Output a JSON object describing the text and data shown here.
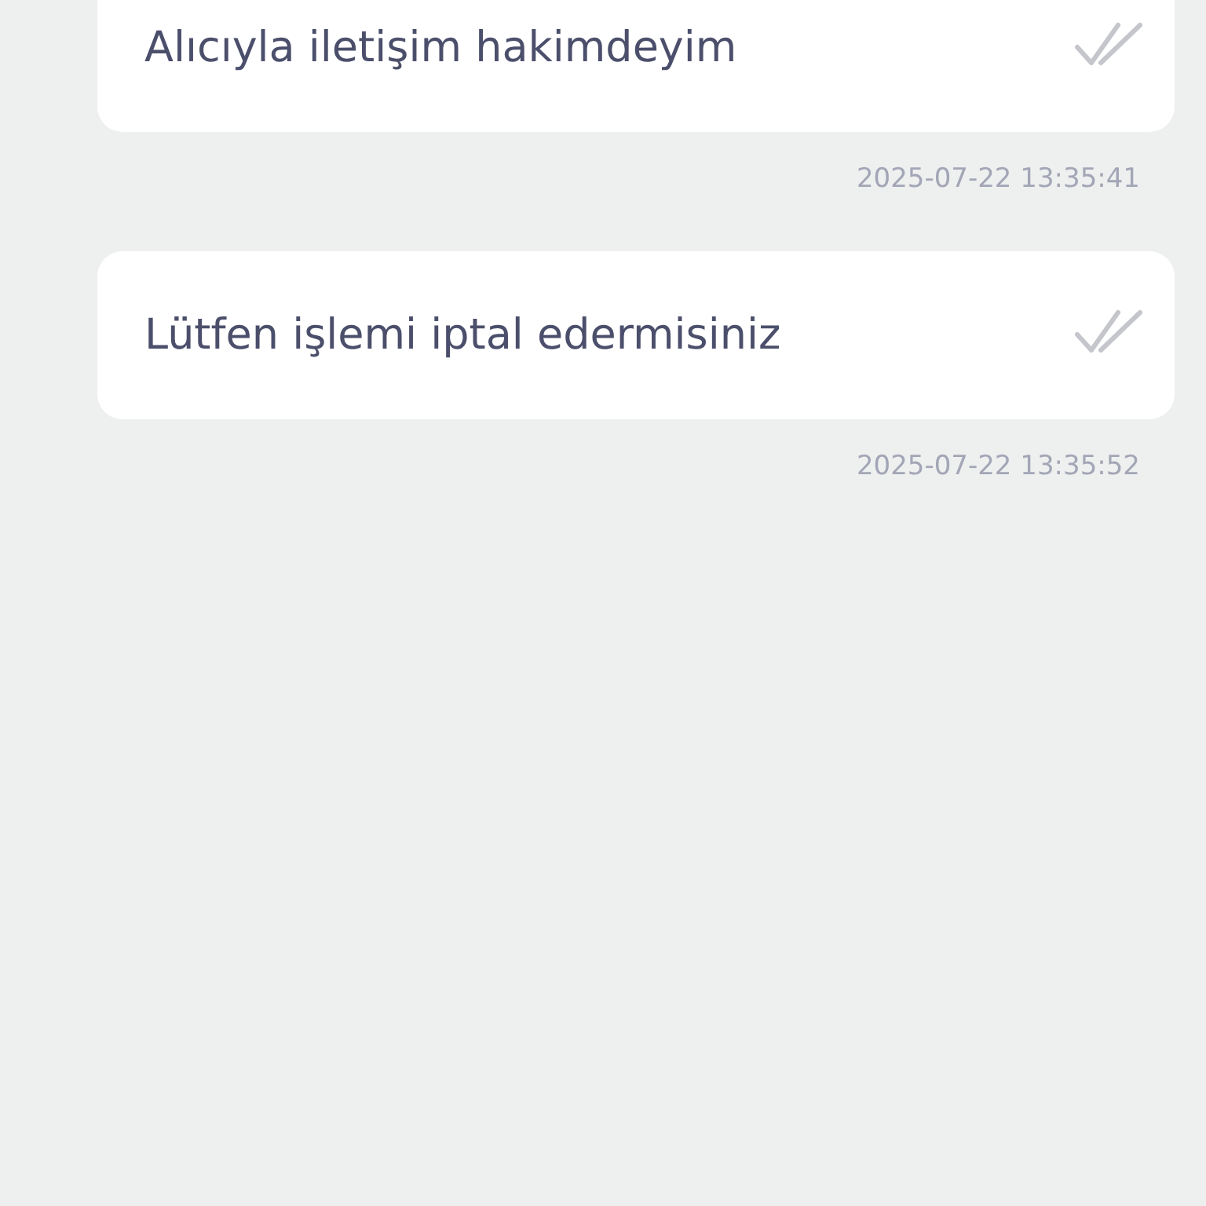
{
  "messages": [
    {
      "text": "Alıcıyla iletişim hakimdeyim",
      "time": "2025-07-22 13:35:41"
    },
    {
      "text": "Lütfen işlemi iptal edermisiniz",
      "time": "2025-07-22 13:35:52"
    }
  ]
}
